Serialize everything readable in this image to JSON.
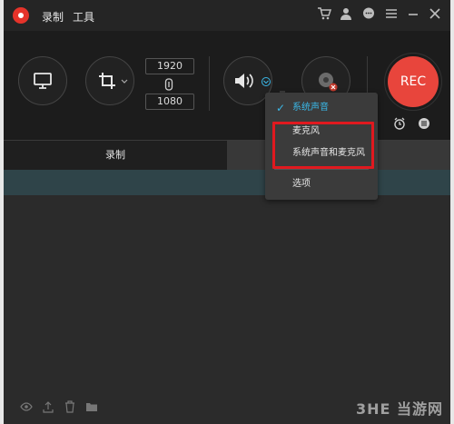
{
  "titlebar": {
    "menu_record": "录制",
    "menu_tools": "工具"
  },
  "toolbar": {
    "res_width": "1920",
    "res_height": "1080",
    "rec_label": "REC"
  },
  "tabs": {
    "record_label": "录制"
  },
  "dropdown": {
    "items": [
      {
        "label": "系统声音",
        "checked": true
      },
      {
        "label": "麦克风"
      },
      {
        "label": "系统声音和麦克风"
      },
      {
        "label": "选项"
      }
    ]
  },
  "watermark": "3HE 当游网",
  "colors": {
    "accent": "#3ab8e8",
    "rec": "#e8453c",
    "highlight": "#e0191f",
    "list_header": "#2f4449"
  },
  "icons": [
    "app-logo-icon",
    "cart-icon",
    "user-icon",
    "chat-icon",
    "menu-icon",
    "minimize-icon",
    "close-icon",
    "monitor-icon",
    "crop-icon",
    "lock-icon",
    "speaker-icon",
    "webcam-icon",
    "alarm-icon",
    "list-icon",
    "eye-icon",
    "upload-icon",
    "trash-icon",
    "folder-icon"
  ]
}
